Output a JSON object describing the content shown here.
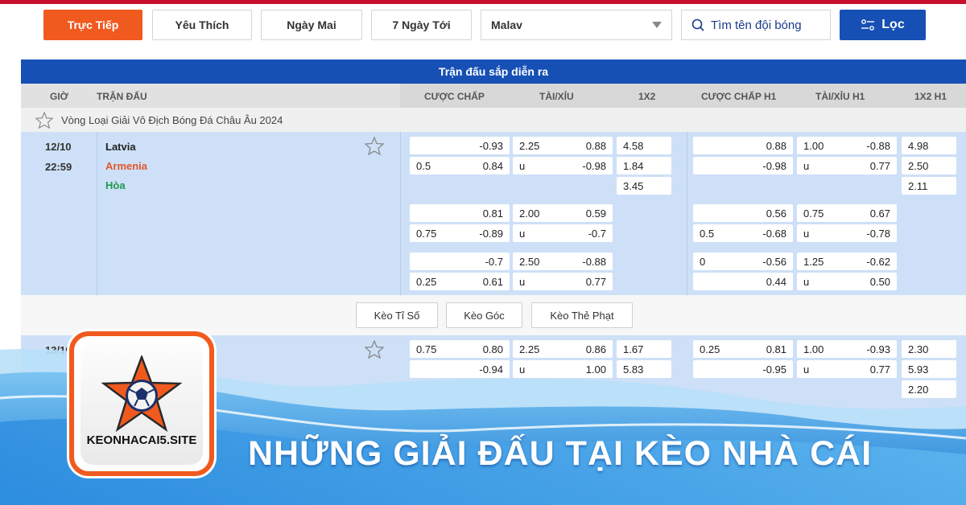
{
  "tabs": [
    "Trực Tiếp",
    "Yêu Thích",
    "Ngày Mai",
    "7 Ngày Tới"
  ],
  "select_value": "Malav",
  "search_placeholder": "Tìm tên đội bóng",
  "filter_label": "Lọc",
  "banner": "Trận đấu sắp diễn ra",
  "columns": {
    "time": "GIỜ",
    "match": "TRẬN ĐẤU",
    "handicap": "CƯỢC CHẤP",
    "overunder": "TÀI/XỈU",
    "onextwo": "1X2",
    "handicap_h1": "CƯỢC CHẤP H1",
    "overunder_h1": "TÀI/XỈU H1",
    "onextwo_h1": "1X2 H1"
  },
  "league": "Vòng Loại Giải Vô Địch Bóng Đá Châu Âu 2024",
  "match1": {
    "date": "12/10",
    "time": "22:59",
    "home": "Latvia",
    "away": "Armenia",
    "draw": "Hòa",
    "rows": [
      [
        "",
        "-0.93",
        "2.25",
        "0.88",
        "4.58",
        "",
        "0.88",
        "1.00",
        "-0.88",
        "4.98"
      ],
      [
        "0.5",
        "0.84",
        "u",
        "-0.98",
        "1.84",
        "",
        "-0.98",
        "u",
        "0.77",
        "2.50"
      ],
      [
        "",
        "",
        "",
        "",
        "3.45",
        "",
        "",
        "",
        "",
        "2.11"
      ],
      [
        "",
        "0.81",
        "2.00",
        "0.59",
        "",
        "",
        "0.56",
        "0.75",
        "0.67",
        ""
      ],
      [
        "0.75",
        "-0.89",
        "u",
        "-0.7",
        "",
        "0.5",
        "-0.68",
        "u",
        "-0.78",
        ""
      ],
      [
        "",
        "-0.7",
        "2.50",
        "-0.88",
        "",
        "0",
        "-0.56",
        "1.25",
        "-0.62",
        ""
      ],
      [
        "0.25",
        "0.61",
        "u",
        "0.77",
        "",
        "",
        "0.44",
        "u",
        "0.50",
        ""
      ]
    ]
  },
  "subtabs": [
    "Kèo Tỉ Số",
    "Kèo Góc",
    "Kèo Thẻ Phạt"
  ],
  "match2": {
    "date": "13/10",
    "rows": [
      [
        "0.75",
        "0.80",
        "2.25",
        "0.86",
        "1.67",
        "0.25",
        "0.81",
        "1.00",
        "-0.93",
        "2.30"
      ],
      [
        "",
        "-0.94",
        "u",
        "1.00",
        "5.83",
        "",
        "-0.95",
        "u",
        "0.77",
        "5.93"
      ],
      [
        "",
        "",
        "",
        "",
        "",
        "",
        "",
        "",
        "",
        "2.20"
      ]
    ]
  },
  "logo_text": "KEONHACAI5.SITE",
  "headline": "NHỮNG GIẢI ĐẤU TẠI KÈO NHÀ CÁI",
  "colors": {
    "accent": "#f05a1e",
    "brand": "#1650b5",
    "rowbg": "#cde0f7"
  }
}
